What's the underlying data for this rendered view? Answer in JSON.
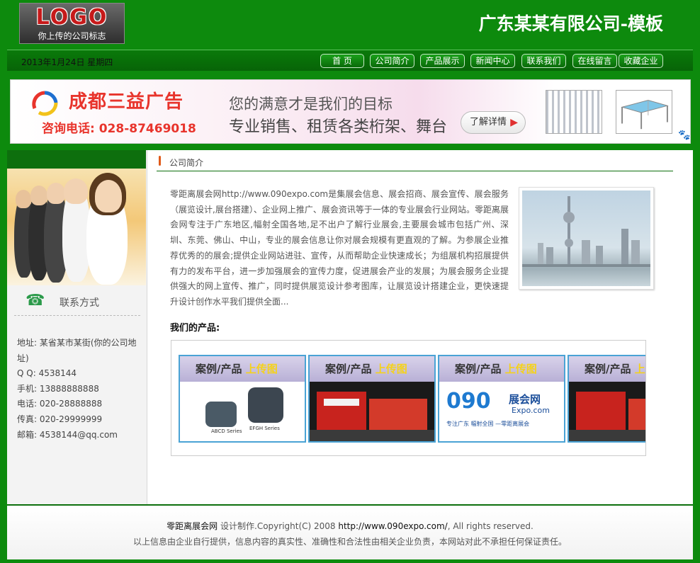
{
  "header": {
    "logo_text": "LOGO",
    "logo_subtext": "你上传的公司标志",
    "site_title": "广东某某有限公司-模板"
  },
  "navbar": {
    "date": "2013年1月24日 星期四",
    "items": [
      {
        "label": "首  页"
      },
      {
        "label": "公司简介"
      },
      {
        "label": "产品展示"
      },
      {
        "label": "新闻中心"
      },
      {
        "label": "联系我们"
      },
      {
        "label": "在线留言"
      },
      {
        "label": "收藏企业"
      }
    ]
  },
  "banner": {
    "company": "成都三益广告",
    "phone": "咨询电话: 028-87469018",
    "slogan": "您的满意才是我们的目标",
    "service": "专业销售、租赁各类桁架、舞台",
    "more_label": "了解详情",
    "more_arrow": "▶",
    "paw": "🐾"
  },
  "sidebar": {
    "contact_heading": "联系方式",
    "phone_icon": "☎",
    "contact": {
      "address": "地址: 某省某市某街(你的公司地址)",
      "qq": "Q Q: 4538144",
      "mobile": "手机: 13888888888",
      "tel": "电话: 020-28888888",
      "fax": "传真: 020-29999999",
      "email": "邮箱: 4538144@qq.com"
    }
  },
  "content": {
    "section_title": "公司简介",
    "intro": "零距离展会网http://www.090expo.com是集展会信息、展会招商、展会宣传、展会服务（展览设计,展台搭建）、企业网上推广、展会资讯等于一体的专业展会行业网站。零距离展会网专注于广东地区,幅射全国各地,足不出户了解行业展会,主要展会城市包括广州、深圳、东莞、佛山、中山，专业的展会信息让你对展会规模有更直观的了解。为参展企业推荐优秀的的展会;提供企业网站进驻、宣传，从而帮助企业快速成长；为组展机构招展提供有力的发布平台，进一步加强展会的宣传力度，促进展会产业的发展；为展会服务企业提供强大的网上宣传、推广，同时提供展览设计参考图库，让展览设计搭建企业，更快速提升设计创作水平我们提供全面...",
    "products_heading": "我们的产品:",
    "products": [
      {
        "label": "案例/产品",
        "upload": "上传图",
        "image": "motor"
      },
      {
        "label": "案例/产品",
        "upload": "上传图",
        "image": "booth"
      },
      {
        "label": "案例/产品",
        "upload": "上传图",
        "image": "090expo-logo"
      },
      {
        "label": "案例/产品",
        "upload": "上传图",
        "image": "booth"
      }
    ],
    "motor_captions": [
      "ABCD Series",
      "EFGH Series"
    ],
    "expo_logo": {
      "big": "090",
      "cn": "展会网",
      "en": "Expo.com",
      "tag": "专注广东  幅射全国  —零距离展会"
    }
  },
  "footer": {
    "site_name": "零距离展会网",
    "design_text": "设计制作.Copyright(C) 2008",
    "url": "http://www.090expo.com/",
    "rights": ", All rights reserved.",
    "disclaimer": "以上信息由企业自行提供，信息内容的真实性、准确性和合法性由相关企业负责，本网站对此不承担任何保证责任。"
  }
}
